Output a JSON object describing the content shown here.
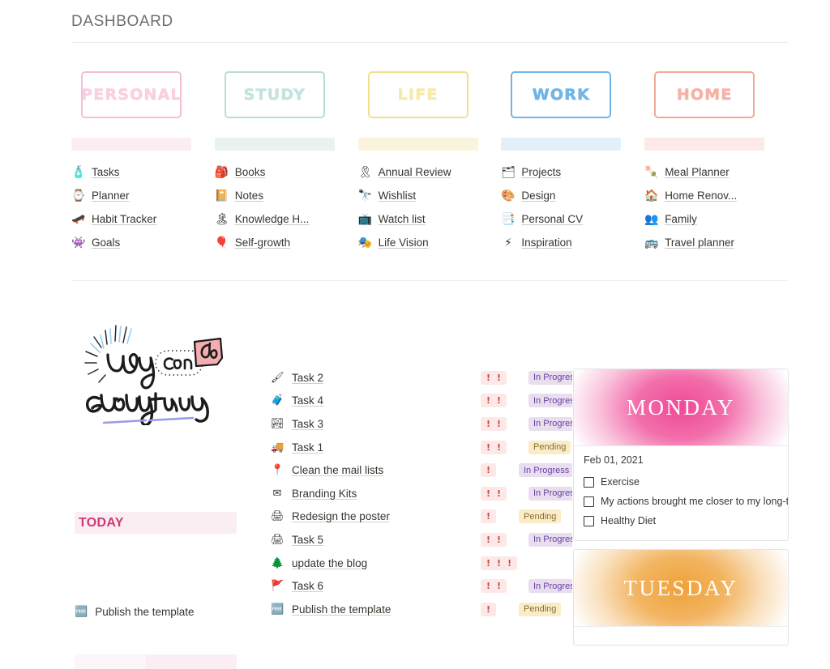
{
  "header": {
    "title": "DASHBOARD"
  },
  "categories": [
    {
      "title": "PERSONAL",
      "border_color": "#f6bdd6",
      "title_color": "#f9cfe2",
      "bar_color": "#fbeef2",
      "links": [
        {
          "icon": "spray-bottle-icon",
          "emoji": "🧴",
          "label": "Tasks"
        },
        {
          "icon": "watch-icon",
          "emoji": "⌚",
          "label": "Planner"
        },
        {
          "icon": "roller-skate-icon",
          "emoji": "🛹",
          "label": "Habit Tracker"
        },
        {
          "icon": "alien-icon",
          "emoji": "👾",
          "label": "Goals"
        }
      ]
    },
    {
      "title": "STUDY",
      "border_color": "#b8dcd8",
      "title_color": "#c4e3df",
      "bar_color": "#e9f2f0",
      "links": [
        {
          "icon": "school-backpack-icon",
          "emoji": "🎒",
          "label": "Books"
        },
        {
          "icon": "notebook-icon",
          "emoji": "📔",
          "label": "Notes"
        },
        {
          "icon": "island-icon",
          "emoji": "🏝",
          "label": "Knowledge H..."
        },
        {
          "icon": "hot-air-balloon-icon",
          "emoji": "🎈",
          "label": "Self-growth"
        }
      ]
    },
    {
      "title": "LIFE",
      "border_color": "#f3e08e",
      "title_color": "#f7e9a8",
      "bar_color": "#fbf4dc",
      "links": [
        {
          "icon": "ribbon-icon",
          "emoji": "🎗",
          "label": "Annual Review"
        },
        {
          "icon": "binoculars-icon",
          "emoji": "🔭",
          "label": "Wishlist"
        },
        {
          "icon": "television-icon",
          "emoji": "📺",
          "label": "Watch list"
        },
        {
          "icon": "mask-icon",
          "emoji": "🎭",
          "label": "Life Vision"
        }
      ]
    },
    {
      "title": "WORK",
      "border_color": "#6fb5e8",
      "title_color": "#6fb5e8",
      "bar_color": "#e3f0fa",
      "links": [
        {
          "icon": "projects-icon",
          "emoji": "🗂",
          "label": "Projects"
        },
        {
          "icon": "design-icon",
          "emoji": "🎨",
          "label": "Design"
        },
        {
          "icon": "cv-icon",
          "emoji": "📑",
          "label": "Personal CV"
        },
        {
          "icon": "lightning-icon",
          "emoji": "⚡",
          "label": "Inspiration"
        }
      ]
    },
    {
      "title": "HOME",
      "border_color": "#f4a89b",
      "title_color": "#f6b2a6",
      "bar_color": "#fbeae8",
      "links": [
        {
          "icon": "food-icon",
          "emoji": "🍡",
          "label": "Meal Planner"
        },
        {
          "icon": "house-icon",
          "emoji": "🏠",
          "label": "Home Renov..."
        },
        {
          "icon": "family-icon",
          "emoji": "👥",
          "label": "Family"
        },
        {
          "icon": "bus-icon",
          "emoji": "🚌",
          "label": "Travel planner"
        }
      ]
    }
  ],
  "illustration": {
    "line1": "you",
    "line2": "can",
    "line3": "do",
    "line4": "everything",
    "accent_color": "#f0a9ad",
    "ray_color": "#9ecfee",
    "underline_color": "#9a9aea"
  },
  "today": {
    "label": "TODAY",
    "label_color": "#cc3a74",
    "bar_color": "#fbeef2",
    "items": [
      {
        "icon": "free-badge-icon",
        "emoji": "🆓",
        "label": "Publish the template"
      }
    ]
  },
  "tasks": [
    {
      "icon": "paintbrush-icon",
      "emoji": "🖌",
      "label": "Task 2",
      "priority": 2,
      "status": "In Progress"
    },
    {
      "icon": "suitcase-icon",
      "emoji": "🧳",
      "label": "Task 4",
      "priority": 2,
      "status": "In Progress"
    },
    {
      "icon": "landscape-icon",
      "emoji": "🏞",
      "label": "Task 3",
      "priority": 2,
      "status": "In Progress"
    },
    {
      "icon": "truck-icon",
      "emoji": "🚚",
      "label": "Task 1",
      "priority": 2,
      "status": "Pending"
    },
    {
      "icon": "pin-icon",
      "emoji": "📍",
      "label": "Clean the mail lists",
      "priority": 1,
      "status": "In Progress"
    },
    {
      "icon": "envelope-icon",
      "emoji": "✉",
      "label": "Branding Kits",
      "priority": 2,
      "status": "In Progress"
    },
    {
      "icon": "printer-icon",
      "emoji": "🖨",
      "label": "Redesign the poster",
      "priority": 1,
      "status": "Pending"
    },
    {
      "icon": "printer-icon",
      "emoji": "🖨",
      "label": "Task 5",
      "priority": 2,
      "status": "In Progress"
    },
    {
      "icon": "tree-icon",
      "emoji": "🌲",
      "label": "update the blog",
      "priority": 3,
      "status": ""
    },
    {
      "icon": "flag-icon",
      "emoji": "🚩",
      "label": "Task 6",
      "priority": 2,
      "status": "In Progress"
    },
    {
      "icon": "free-badge-icon",
      "emoji": "🆓",
      "label": "Publish the template",
      "priority": 1,
      "status": "Pending"
    }
  ],
  "priority_mark": "!",
  "status_colors": {
    "in_progress_bg": "#e8deee",
    "in_progress_fg": "#6940a5",
    "pending_bg": "#fbecc8",
    "pending_fg": "#876d32",
    "priority_bg": "#fde8e8",
    "priority_fg": "#d04545"
  },
  "day_cards": [
    {
      "title": "MONDAY",
      "cover_color": "#ef4a96",
      "date": "Feb 01, 2021",
      "checks": [
        "Exercise",
        "My actions brought me closer to my long-term go",
        "Healthy Diet"
      ]
    },
    {
      "title": "TUESDAY",
      "cover_color": "#efa23a",
      "date": "",
      "checks": []
    }
  ]
}
